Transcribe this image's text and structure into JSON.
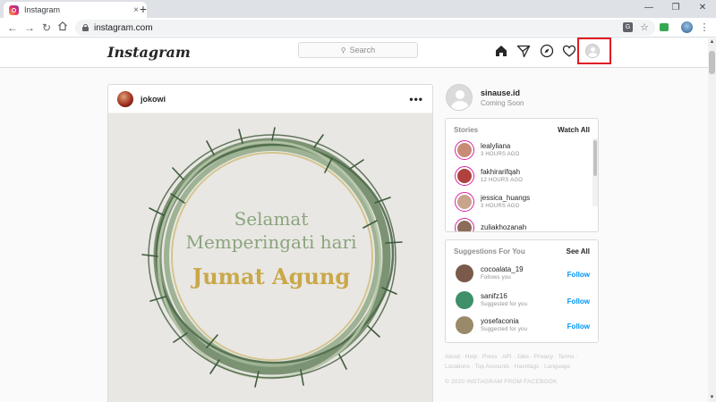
{
  "browser": {
    "tab_title": "Instagram",
    "url": "instagram.com",
    "new_tab_symbol": "+",
    "close_symbol": "×",
    "window_controls": [
      "—",
      "❐",
      "✕"
    ]
  },
  "header": {
    "logo": "Instagram",
    "search_placeholder": "Search",
    "highlight_color": "#e01b24"
  },
  "post": {
    "username": "jokowi",
    "more": "•••",
    "image_text": {
      "line1": "Selamat",
      "line2": "Memperingati hari",
      "line3": "Jumat Agung"
    }
  },
  "profile": {
    "username": "sinause.id",
    "status": "Coming Soon"
  },
  "stories": {
    "title": "Stories",
    "action": "Watch All",
    "items": [
      {
        "name": "lealyliana",
        "time": "3 HOURS AGO",
        "color": "#c98b78"
      },
      {
        "name": "fakhirarifqah",
        "time": "12 HOURS AGO",
        "color": "#b0413e"
      },
      {
        "name": "jessica_huangs",
        "time": "3 HOURS AGO",
        "color": "#caa38d"
      },
      {
        "name": "zuliakhozanah",
        "time": "",
        "color": "#8c6b5a"
      }
    ]
  },
  "suggestions": {
    "title": "Suggestions For You",
    "action": "See All",
    "follow_label": "Follow",
    "items": [
      {
        "name": "cocoalata_19",
        "sub": "Follows you",
        "color": "#7a5a4a"
      },
      {
        "name": "sanifz16",
        "sub": "Suggested for you",
        "color": "#3f8f6a"
      },
      {
        "name": "yosefaconia",
        "sub": "Suggested for you",
        "color": "#9a8a6a"
      }
    ]
  },
  "footer": {
    "links": "About · Help · Press · API · Jobs · Privacy · Terms · Locations · Top Accounts · Hashtags · Language",
    "copyright": "© 2020 INSTAGRAM FROM FACEBOOK"
  }
}
